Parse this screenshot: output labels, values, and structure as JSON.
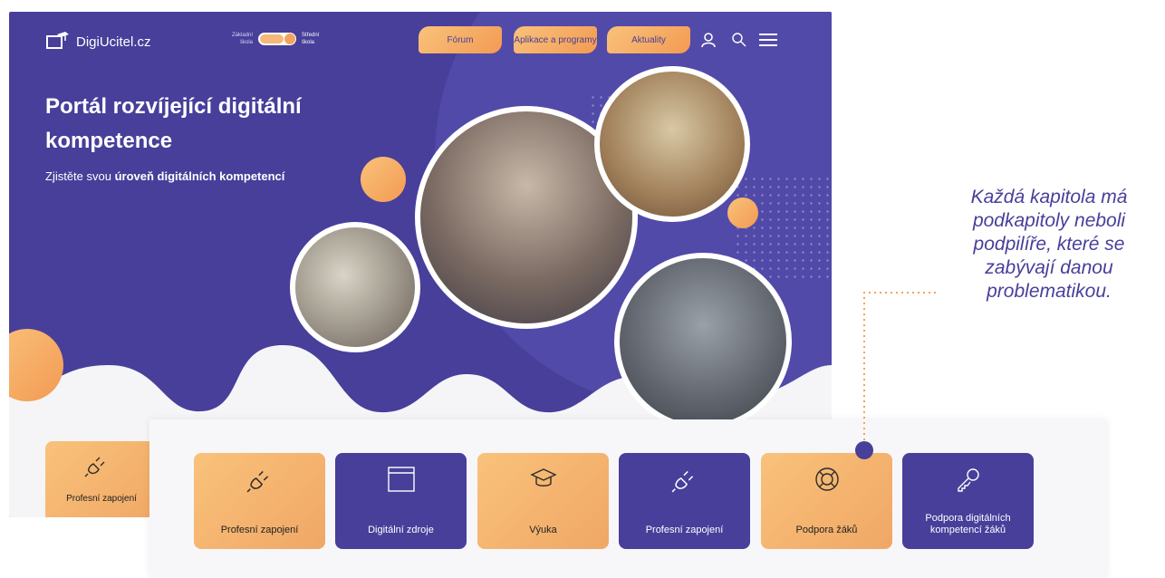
{
  "brand": {
    "name": "DigiUcitel.cz"
  },
  "toggle": {
    "left_line1": "Základní",
    "left_line2": "škola",
    "right_line1": "Střední",
    "right_line2": "škola"
  },
  "nav": {
    "forum": "Fórum",
    "apps": "Aplikace a programy",
    "news": "Aktuality"
  },
  "hero": {
    "title": "Portál rozvíjející digitální kompetence",
    "sub_plain": "Zjistěte svou ",
    "sub_bold": "úroveň digitálních kompetencí"
  },
  "back_card": {
    "label": "Profesní zapojení"
  },
  "cards": [
    {
      "label": "Profesní zapojení",
      "icon": "plug-icon"
    },
    {
      "label": "Digitální zdroje",
      "icon": "window-icon"
    },
    {
      "label": "Výuka",
      "icon": "graduation-cap-icon"
    },
    {
      "label": "Profesní zapojení",
      "icon": "plug-icon"
    },
    {
      "label": "Podpora žáků",
      "icon": "lifebuoy-icon"
    },
    {
      "label": "Podpora digitálních kompetencí žáků",
      "icon": "key-icon"
    }
  ],
  "note": "Každá kapitola má\npodkapitoly neboli\npodpilíře, které se\nzabývají danou\nproblematikou.",
  "colors": {
    "primary": "#473f9a",
    "accent": "#f3a35d"
  }
}
